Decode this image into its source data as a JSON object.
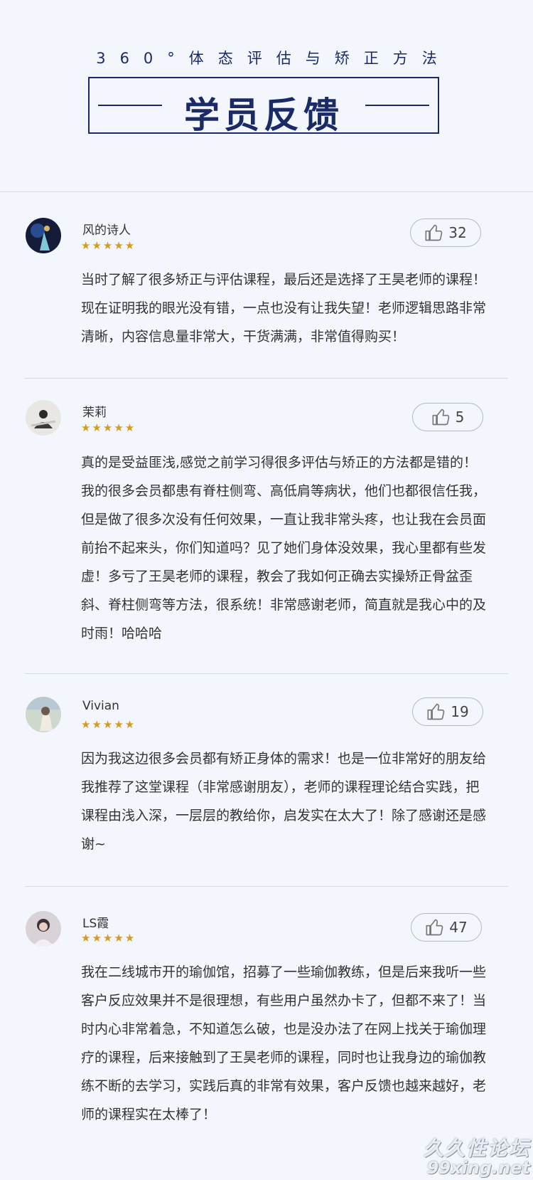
{
  "header": {
    "subtitle": "360°体态评估与矫正方法",
    "title": "学员反馈"
  },
  "colors": {
    "brand": "#1a2a66",
    "star": "#d59a21",
    "background": "#f3f6fc"
  },
  "reviews": [
    {
      "name": "风的诗人",
      "stars": "★★★★★",
      "likes": "32",
      "text": "当时了解了很多矫正与评估课程，最后还是选择了王昊老师的课程！现在证明我的眼光没有错，一点也没有让我失望！老师逻辑思路非常清晰，内容信息量非常大，干货满满，非常值得购买！"
    },
    {
      "name": "茉莉",
      "stars": "★★★★★",
      "likes": "5",
      "text": "真的是受益匪浅,感觉之前学习得很多评估与矫正的方法都是错的！我的很多会员都患有脊柱侧弯、高低肩等病状，他们也都很信任我，但是做了很多次没有任何效果，一直让我非常头疼，也让我在会员面前抬不起来头，你们知道吗？见了她们身体没效果，我心里都有些发虚！多亏了王昊老师的课程，教会了我如何正确去实操矫正骨盆歪斜、脊柱侧弯等方法，很系统！非常感谢老师，简直就是我心中的及时雨！哈哈哈"
    },
    {
      "name": "Vivian",
      "stars": "★★★★★",
      "likes": "19",
      "text": "因为我这边很多会员都有矫正身体的需求！也是一位非常好的朋友给我推荐了这堂课程（非常感谢朋友），老师的课程理论结合实践，把课程由浅入深，一层层的教给你，启发实在太大了！除了感谢还是感谢~"
    },
    {
      "name": "LS霞",
      "stars": "★★★★★",
      "likes": "47",
      "text": "我在二线城市开的瑜伽馆，招募了一些瑜伽教练，但是后来我听一些客户反应效果并不是很理想，有些用户虽然办卡了，但都不来了！当时内心非常着急，不知道怎么破，也是没办法了在网上找关于瑜伽理疗的课程，后来接触到了王昊老师的课程，同时也让我身边的瑜伽教练不断的去学习，实践后真的非常有效果，客户反馈也越来越好，老师的课程实在太棒了！"
    }
  ],
  "watermark": {
    "line1": "久久性论坛",
    "line2": "99xing.net"
  }
}
